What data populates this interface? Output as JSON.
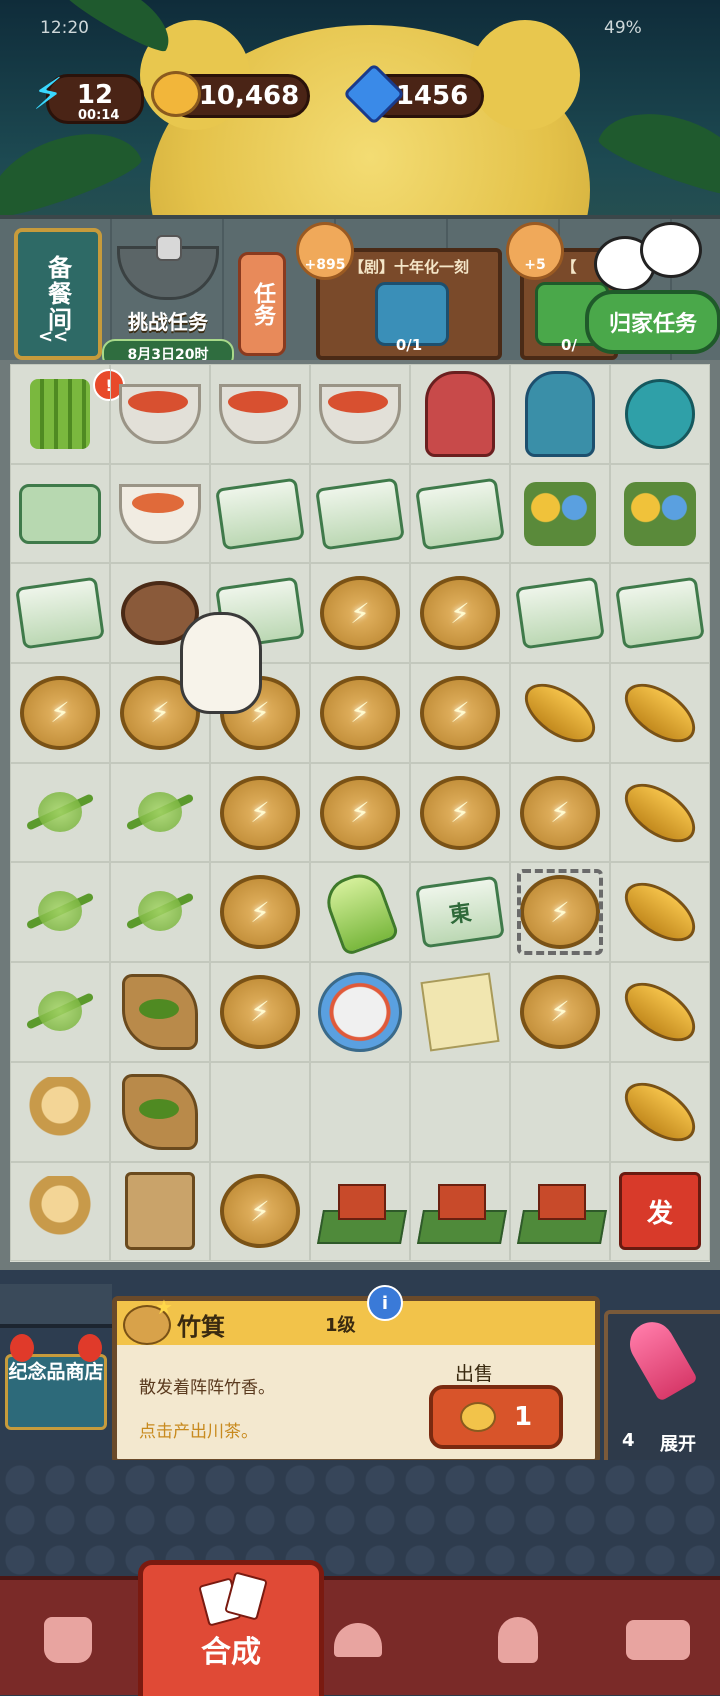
{
  "status_bar": {
    "time": "12:20",
    "battery": "49%"
  },
  "resources": {
    "energy": {
      "value": "12",
      "timer": "00:14"
    },
    "coins": {
      "value": "10,468"
    },
    "gems": {
      "value": "1456"
    }
  },
  "top": {
    "kitchen_label": "备餐间",
    "kitchen_arrow": "<<",
    "challenge_label": "挑战任务",
    "challenge_date": "8月3日20时",
    "task_label": "任务",
    "orders": [
      {
        "title": "【剧】十年化一刻",
        "progress": "0/1",
        "reward": "+895"
      },
      {
        "title": "【",
        "progress": "0/",
        "reward": "+5"
      }
    ],
    "home_task_label": "归家任务"
  },
  "board": {
    "rows": [
      [
        "bamboo",
        "skewer",
        "skewer",
        "skewer",
        "opera",
        "opera2",
        "tea"
      ],
      [
        "steamer",
        "bowl2",
        "mahjong",
        "mahjong",
        "mahjong",
        "flowers",
        "flowers"
      ],
      [
        "mahjong",
        "bamboo-ring",
        "mahjong",
        "coin",
        "coin",
        "mahjong",
        "mahjong"
      ],
      [
        "coin",
        "coin",
        "coin",
        "coin",
        "coin",
        "boat",
        "boat"
      ],
      [
        "dragonfly",
        "dragonfly",
        "coin",
        "coin",
        "coin",
        "coin",
        "boat"
      ],
      [
        "dragonfly",
        "dragonfly",
        "coin",
        "shoot",
        "mahjong",
        "coin",
        "boat"
      ],
      [
        "dragonfly",
        "leafboard",
        "coin",
        "plate",
        "paper",
        "coin",
        "boat"
      ],
      [
        "phoenix",
        "leafboard",
        "empty",
        "empty",
        "empty",
        "empty",
        "boat"
      ],
      [
        "phoenix",
        "teabag",
        "coin",
        "pavilion",
        "pavilion",
        "pavilion",
        "giftbox"
      ]
    ],
    "alert_symbol": "!",
    "energy_symbol": "⚡",
    "mahjong_glyph": "東",
    "giftbox_glyph": "发",
    "selected_cell": {
      "row": 5,
      "col": 5
    }
  },
  "info_panel": {
    "shop_label": "纪念品商店",
    "item_name": "竹箕",
    "item_level": "1级",
    "info_symbol": "i",
    "description": "散发着阵阵竹香。",
    "hint": "点击产出川茶。",
    "sell_label": "出售",
    "sell_price": "1",
    "expand_count": "4",
    "expand_label": "展开"
  },
  "nav": {
    "active_label": "合成",
    "items": [
      "bag",
      "merge",
      "bell",
      "map",
      "bus"
    ]
  }
}
